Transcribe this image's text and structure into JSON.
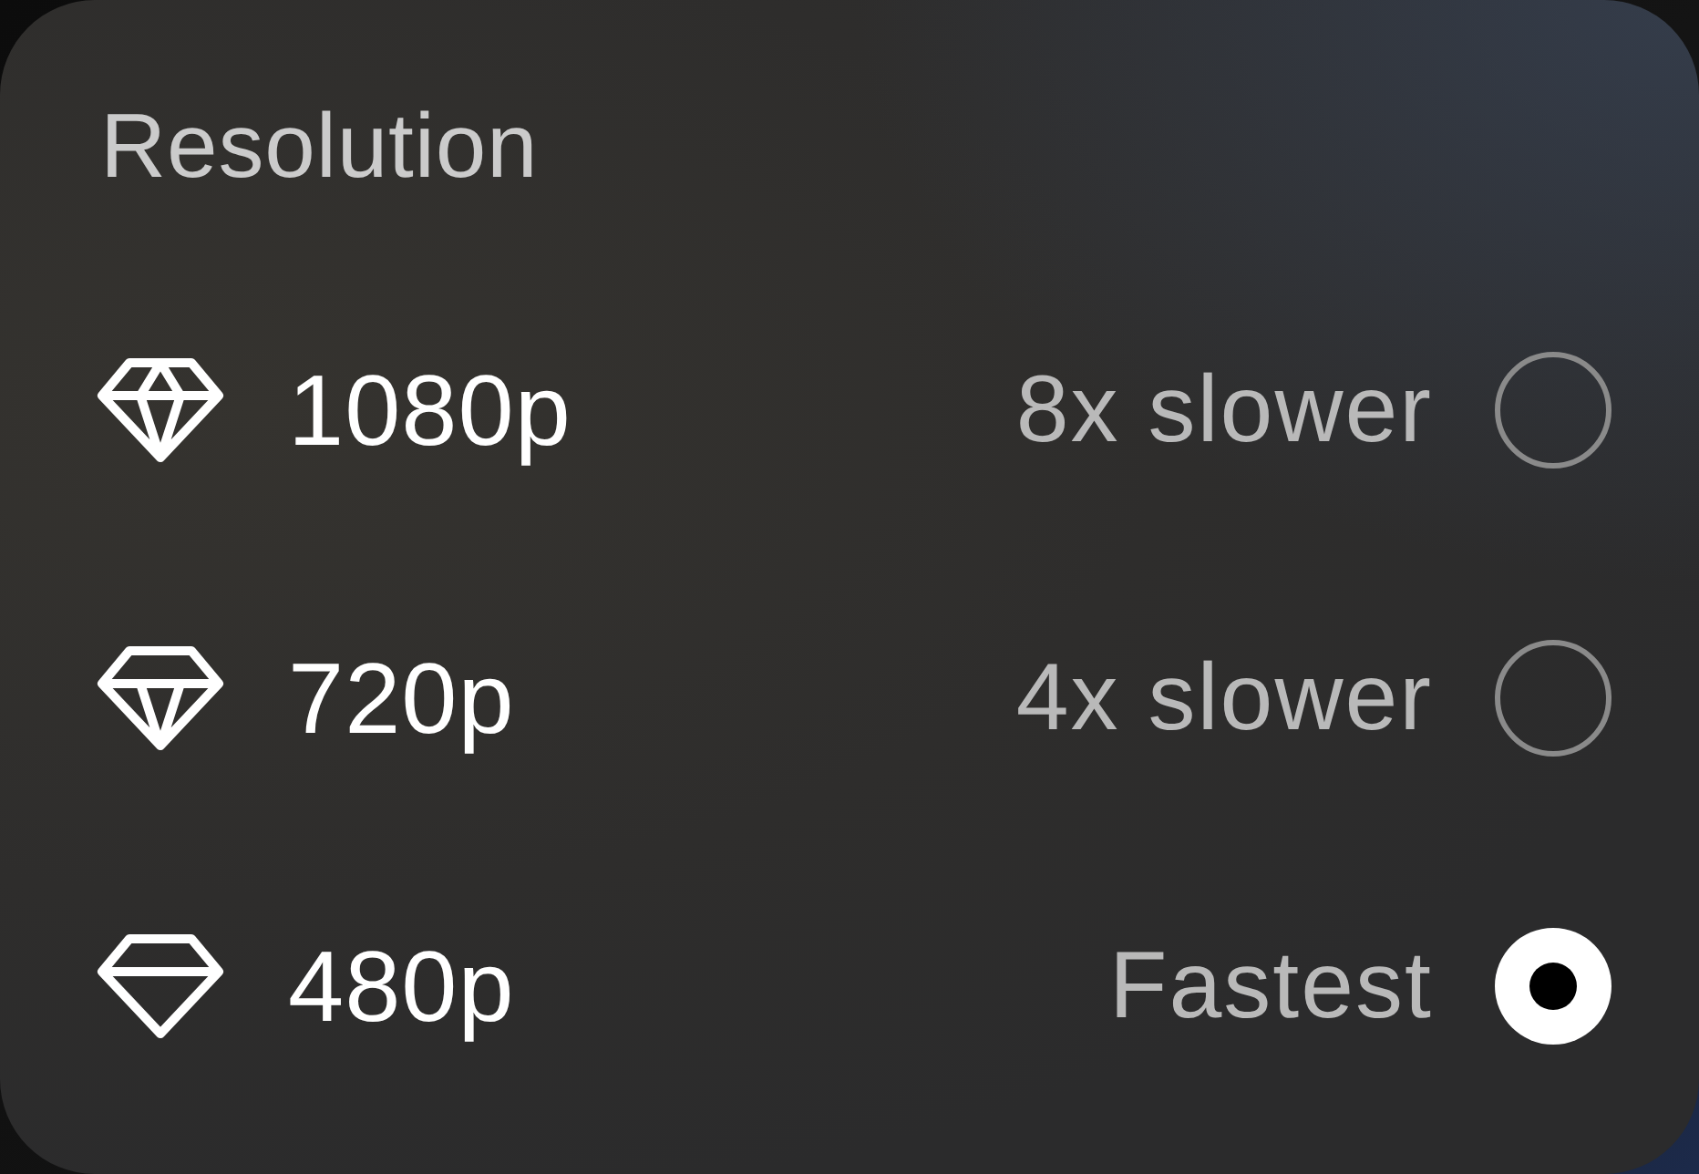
{
  "title": "Resolution",
  "options": [
    {
      "label": "1080p",
      "speed": "8x slower",
      "selected": false
    },
    {
      "label": "720p",
      "speed": "4x slower",
      "selected": false
    },
    {
      "label": "480p",
      "speed": "Fastest",
      "selected": true
    }
  ]
}
